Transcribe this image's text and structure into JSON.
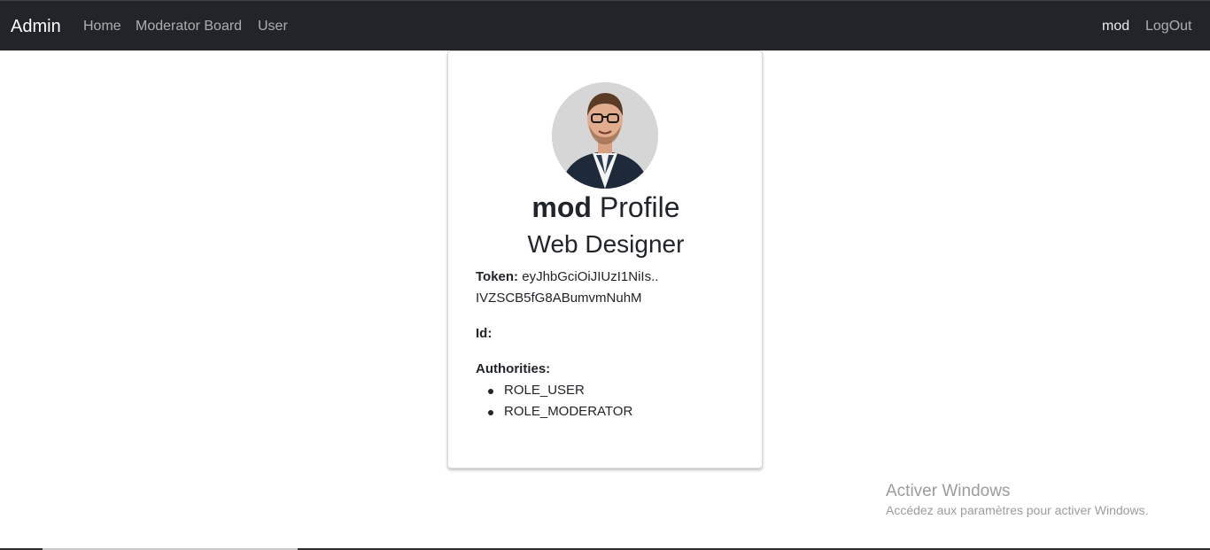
{
  "navbar": {
    "brand": "Admin",
    "links": [
      "Home",
      "Moderator Board",
      "User"
    ],
    "username": "mod",
    "logout": "LogOut"
  },
  "profile": {
    "username": "mod",
    "title_suffix": "Profile",
    "job": "Web Designer",
    "token_label": "Token:",
    "token_start": "eyJhbGciOiJIUzI1NiIs..",
    "token_end": "IVZSCB5fG8ABumvmNuhM",
    "id_label": "Id:",
    "id_value": "",
    "authorities_label": "Authorities:",
    "authorities": [
      "ROLE_USER",
      "ROLE_MODERATOR"
    ]
  },
  "watermark": {
    "title": "Activer Windows",
    "subtitle": "Accédez aux paramètres pour activer Windows."
  },
  "colors": {
    "navbar_bg": "#212529",
    "text": "#212529"
  }
}
